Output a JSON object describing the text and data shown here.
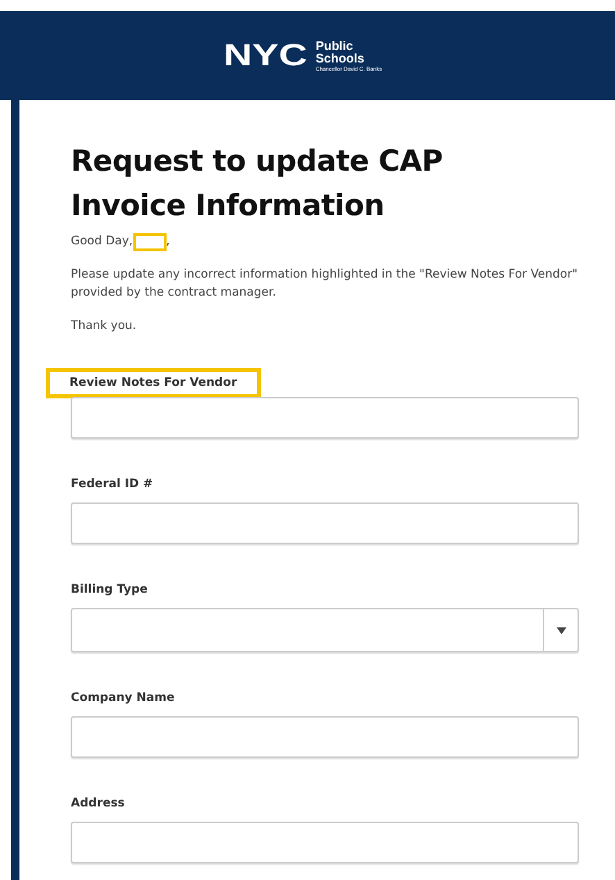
{
  "header": {
    "logo_mark": "NYC",
    "logo_title": "Public Schools",
    "logo_subtitle": "Chancellor David C. Banks"
  },
  "title": "Request to update CAP Invoice Information",
  "greeting": {
    "text": "Good Day,",
    "name_redacted": true,
    "suffix": ","
  },
  "paragraphs": [
    "Please update any incorrect information highlighted in the \"Review Notes For Vendor\" provided by the contract manager.",
    "Thank you."
  ],
  "fields": [
    {
      "label": "Review Notes For Vendor",
      "kind": "text",
      "highlighted": true
    },
    {
      "label": "Federal ID #",
      "kind": "text",
      "highlighted": false
    },
    {
      "label": "Billing Type",
      "kind": "select",
      "highlighted": false
    },
    {
      "label": "Company Name",
      "kind": "text",
      "highlighted": false
    },
    {
      "label": "Address",
      "kind": "text",
      "highlighted": false
    }
  ]
}
